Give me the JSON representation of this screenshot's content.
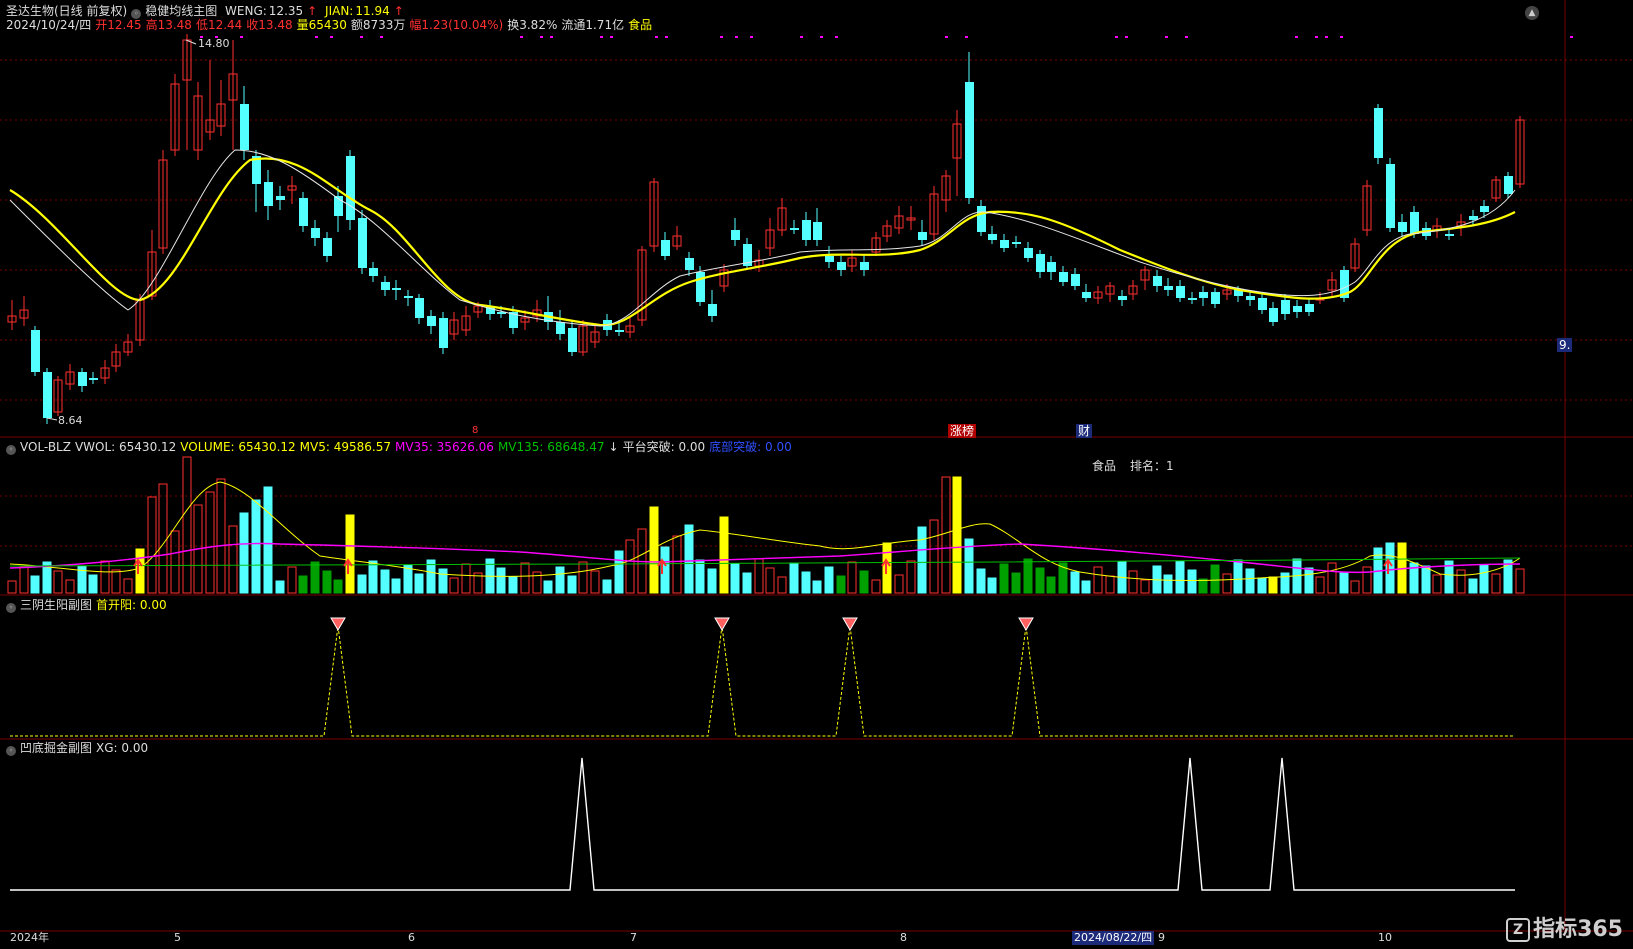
{
  "main": {
    "title": "圣达生物(日线 前复权)",
    "indicator": "稳健均线主图",
    "weng_label": "WENG:",
    "weng_value": "12.35",
    "jian_label": "JIAN:",
    "jian_value": "11.94",
    "info": {
      "date": "2024/10/24/四",
      "open": "开12.45",
      "high": "高13.48",
      "low": "低12.44",
      "close": "收13.48",
      "vol": "量65430",
      "amount": "额8733万",
      "change": "幅1.23(10.04%)",
      "turnover": "换3.82%",
      "float": "流通1.71亿",
      "sector": "食品"
    },
    "price_high": "14.80",
    "price_low": "8.64",
    "right_tag": "9.",
    "event_tags": [
      "涨榜",
      "财"
    ],
    "small_tag": "8"
  },
  "vol": {
    "title": "VOL-BLZ",
    "vwol": "VWOL: 65430.12",
    "volume": "VOLUME: 65430.12",
    "mv5": "MV5: 49586.57",
    "mv35": "MV35: 35626.06",
    "mv135": "MV135: 68648.47",
    "platform": "平台突破: 0.00",
    "platform2": "底部突破: 0.00",
    "rank_sector": "食品",
    "rank_label": "排名：1"
  },
  "sub1": {
    "title": "三阴生阳副图",
    "first_yang": "首开阳: 0.00"
  },
  "sub2": {
    "title": "凹底掘金副图",
    "xg": "XG: 0.00"
  },
  "xaxis": {
    "labels": [
      "2024年",
      "5",
      "6",
      "7",
      "8",
      "9",
      "10"
    ],
    "cursor_date": "2024/08/22/四"
  },
  "logo": "指标365",
  "colors": {
    "up": "#ff3030",
    "down": "#54ffff",
    "ma_yellow": "#ffff00",
    "ma_white": "#e6e6e6",
    "mv35": "#ff00ff",
    "mv135": "#00c000",
    "grid": "#7a0000"
  }
}
